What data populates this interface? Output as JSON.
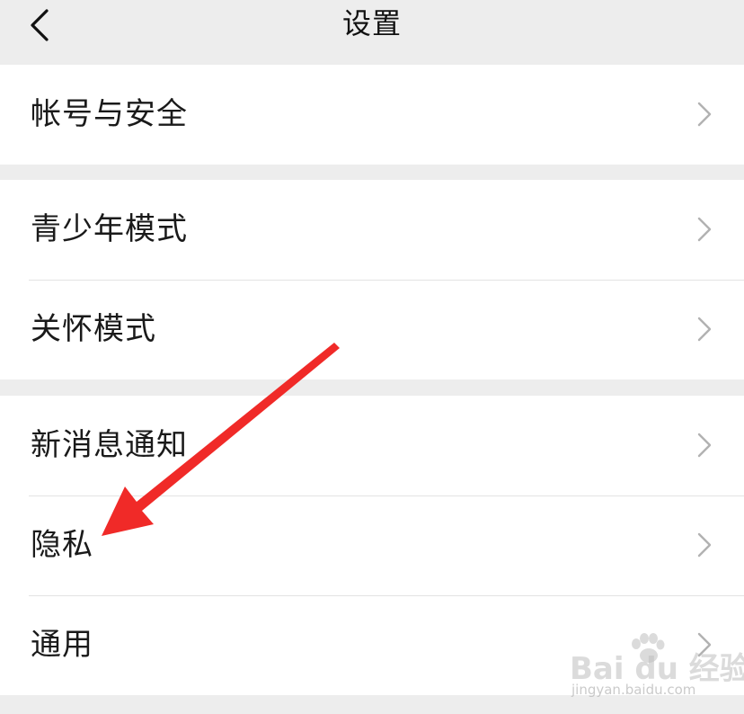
{
  "header": {
    "title": "设置",
    "back_icon": "chevron-left-icon"
  },
  "groups": [
    {
      "items": [
        {
          "label": "帐号与安全",
          "icon": "chevron-right-icon"
        }
      ]
    },
    {
      "items": [
        {
          "label": "青少年模式",
          "icon": "chevron-right-icon"
        },
        {
          "label": "关怀模式",
          "icon": "chevron-right-icon"
        }
      ]
    },
    {
      "items": [
        {
          "label": "新消息通知",
          "icon": "chevron-right-icon"
        },
        {
          "label": "隐私",
          "icon": "chevron-right-icon"
        },
        {
          "label": "通用",
          "icon": "chevron-right-icon"
        }
      ]
    }
  ],
  "annotation": {
    "type": "red-arrow",
    "color": "#f02a28",
    "points_to": "隐私"
  },
  "watermark": {
    "brand": "Bai du 经验",
    "url": "jingyan.baidu.com"
  },
  "colors": {
    "background": "#ededed",
    "row_background": "#ffffff",
    "divider": "#e3e3e3",
    "chevron": "#b2b2b2"
  }
}
